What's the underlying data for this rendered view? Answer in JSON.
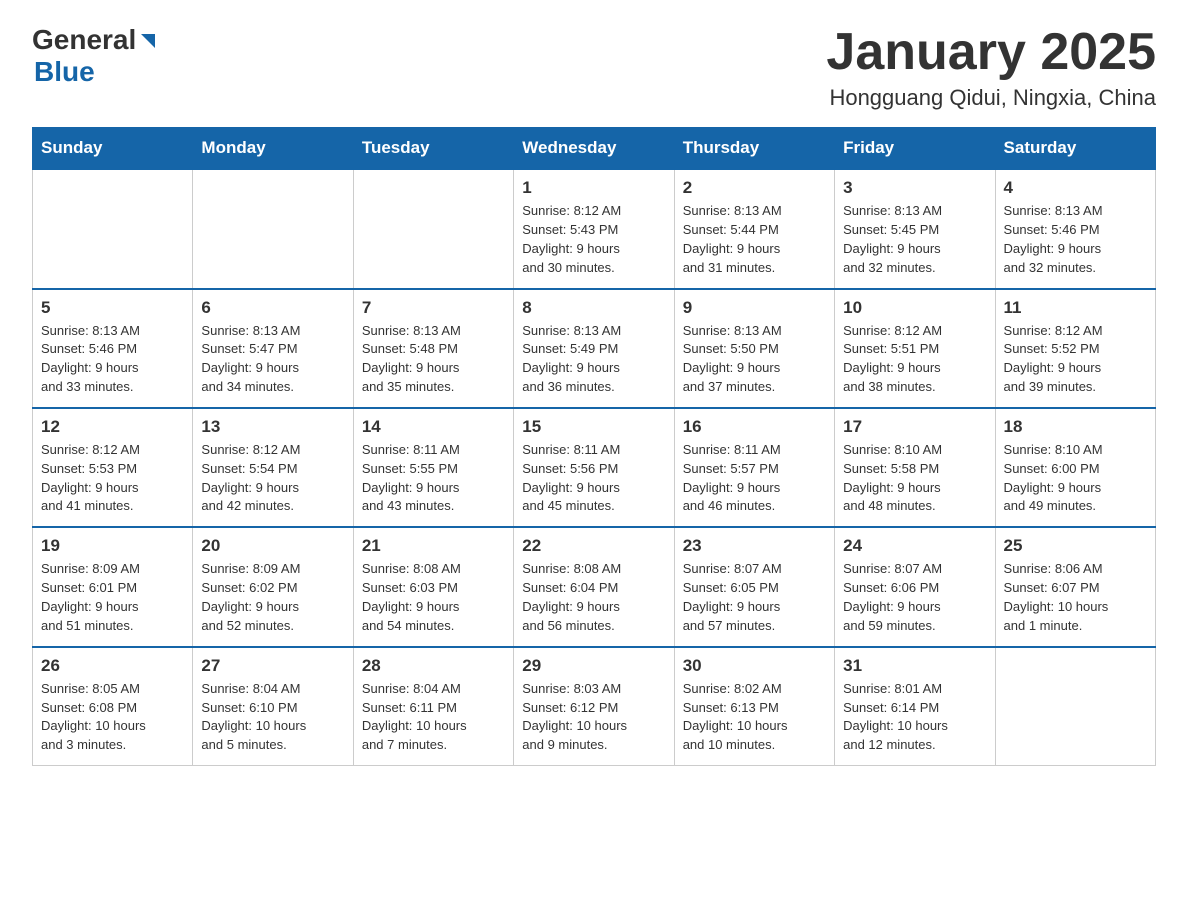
{
  "logo": {
    "general": "General",
    "blue": "Blue"
  },
  "title": "January 2025",
  "subtitle": "Hongguang Qidui, Ningxia, China",
  "days_of_week": [
    "Sunday",
    "Monday",
    "Tuesday",
    "Wednesday",
    "Thursday",
    "Friday",
    "Saturday"
  ],
  "weeks": [
    [
      {
        "day": "",
        "info": ""
      },
      {
        "day": "",
        "info": ""
      },
      {
        "day": "",
        "info": ""
      },
      {
        "day": "1",
        "info": "Sunrise: 8:12 AM\nSunset: 5:43 PM\nDaylight: 9 hours\nand 30 minutes."
      },
      {
        "day": "2",
        "info": "Sunrise: 8:13 AM\nSunset: 5:44 PM\nDaylight: 9 hours\nand 31 minutes."
      },
      {
        "day": "3",
        "info": "Sunrise: 8:13 AM\nSunset: 5:45 PM\nDaylight: 9 hours\nand 32 minutes."
      },
      {
        "day": "4",
        "info": "Sunrise: 8:13 AM\nSunset: 5:46 PM\nDaylight: 9 hours\nand 32 minutes."
      }
    ],
    [
      {
        "day": "5",
        "info": "Sunrise: 8:13 AM\nSunset: 5:46 PM\nDaylight: 9 hours\nand 33 minutes."
      },
      {
        "day": "6",
        "info": "Sunrise: 8:13 AM\nSunset: 5:47 PM\nDaylight: 9 hours\nand 34 minutes."
      },
      {
        "day": "7",
        "info": "Sunrise: 8:13 AM\nSunset: 5:48 PM\nDaylight: 9 hours\nand 35 minutes."
      },
      {
        "day": "8",
        "info": "Sunrise: 8:13 AM\nSunset: 5:49 PM\nDaylight: 9 hours\nand 36 minutes."
      },
      {
        "day": "9",
        "info": "Sunrise: 8:13 AM\nSunset: 5:50 PM\nDaylight: 9 hours\nand 37 minutes."
      },
      {
        "day": "10",
        "info": "Sunrise: 8:12 AM\nSunset: 5:51 PM\nDaylight: 9 hours\nand 38 minutes."
      },
      {
        "day": "11",
        "info": "Sunrise: 8:12 AM\nSunset: 5:52 PM\nDaylight: 9 hours\nand 39 minutes."
      }
    ],
    [
      {
        "day": "12",
        "info": "Sunrise: 8:12 AM\nSunset: 5:53 PM\nDaylight: 9 hours\nand 41 minutes."
      },
      {
        "day": "13",
        "info": "Sunrise: 8:12 AM\nSunset: 5:54 PM\nDaylight: 9 hours\nand 42 minutes."
      },
      {
        "day": "14",
        "info": "Sunrise: 8:11 AM\nSunset: 5:55 PM\nDaylight: 9 hours\nand 43 minutes."
      },
      {
        "day": "15",
        "info": "Sunrise: 8:11 AM\nSunset: 5:56 PM\nDaylight: 9 hours\nand 45 minutes."
      },
      {
        "day": "16",
        "info": "Sunrise: 8:11 AM\nSunset: 5:57 PM\nDaylight: 9 hours\nand 46 minutes."
      },
      {
        "day": "17",
        "info": "Sunrise: 8:10 AM\nSunset: 5:58 PM\nDaylight: 9 hours\nand 48 minutes."
      },
      {
        "day": "18",
        "info": "Sunrise: 8:10 AM\nSunset: 6:00 PM\nDaylight: 9 hours\nand 49 minutes."
      }
    ],
    [
      {
        "day": "19",
        "info": "Sunrise: 8:09 AM\nSunset: 6:01 PM\nDaylight: 9 hours\nand 51 minutes."
      },
      {
        "day": "20",
        "info": "Sunrise: 8:09 AM\nSunset: 6:02 PM\nDaylight: 9 hours\nand 52 minutes."
      },
      {
        "day": "21",
        "info": "Sunrise: 8:08 AM\nSunset: 6:03 PM\nDaylight: 9 hours\nand 54 minutes."
      },
      {
        "day": "22",
        "info": "Sunrise: 8:08 AM\nSunset: 6:04 PM\nDaylight: 9 hours\nand 56 minutes."
      },
      {
        "day": "23",
        "info": "Sunrise: 8:07 AM\nSunset: 6:05 PM\nDaylight: 9 hours\nand 57 minutes."
      },
      {
        "day": "24",
        "info": "Sunrise: 8:07 AM\nSunset: 6:06 PM\nDaylight: 9 hours\nand 59 minutes."
      },
      {
        "day": "25",
        "info": "Sunrise: 8:06 AM\nSunset: 6:07 PM\nDaylight: 10 hours\nand 1 minute."
      }
    ],
    [
      {
        "day": "26",
        "info": "Sunrise: 8:05 AM\nSunset: 6:08 PM\nDaylight: 10 hours\nand 3 minutes."
      },
      {
        "day": "27",
        "info": "Sunrise: 8:04 AM\nSunset: 6:10 PM\nDaylight: 10 hours\nand 5 minutes."
      },
      {
        "day": "28",
        "info": "Sunrise: 8:04 AM\nSunset: 6:11 PM\nDaylight: 10 hours\nand 7 minutes."
      },
      {
        "day": "29",
        "info": "Sunrise: 8:03 AM\nSunset: 6:12 PM\nDaylight: 10 hours\nand 9 minutes."
      },
      {
        "day": "30",
        "info": "Sunrise: 8:02 AM\nSunset: 6:13 PM\nDaylight: 10 hours\nand 10 minutes."
      },
      {
        "day": "31",
        "info": "Sunrise: 8:01 AM\nSunset: 6:14 PM\nDaylight: 10 hours\nand 12 minutes."
      },
      {
        "day": "",
        "info": ""
      }
    ]
  ]
}
